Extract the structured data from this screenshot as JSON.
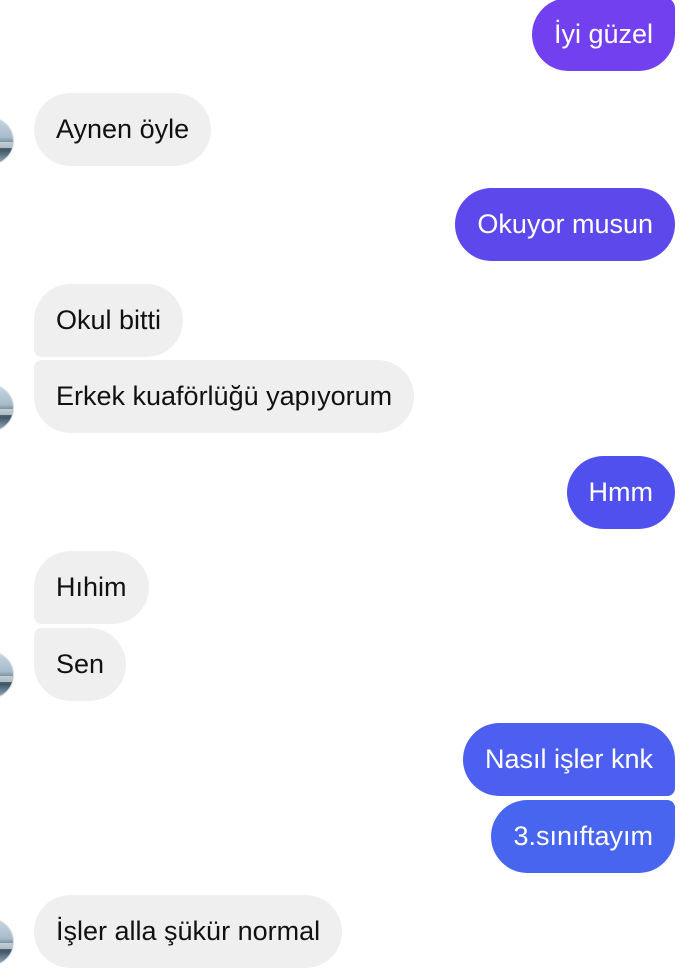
{
  "messages": [
    {
      "side": "out",
      "text": "İyi güzel",
      "color": "#7340ef"
    },
    {
      "side": "in",
      "text": "Aynen öyle"
    },
    {
      "side": "out",
      "text": "Okuyor musun",
      "color": "#5d48ec"
    },
    {
      "side": "in",
      "text": "Okul bitti"
    },
    {
      "side": "in",
      "text": "Erkek kuaförlüğü yapıyorum"
    },
    {
      "side": "out",
      "text": "Hmm",
      "color": "#5050ee"
    },
    {
      "side": "in",
      "text": "Hıhim"
    },
    {
      "side": "in",
      "text": "Sen"
    },
    {
      "side": "out",
      "text": "Nasıl işler knk",
      "color": "#4d5ff0"
    },
    {
      "side": "out",
      "text": "3.sınıftayım",
      "color": "#4865ef"
    },
    {
      "side": "in",
      "text": "İşler alla şükür normal"
    }
  ],
  "avatars": [
    {
      "name": "contact-avatar",
      "icon": "photo-avatar"
    },
    {
      "name": "contact-avatar",
      "icon": "photo-avatar"
    },
    {
      "name": "contact-avatar",
      "icon": "photo-avatar"
    },
    {
      "name": "contact-avatar",
      "icon": "photo-avatar"
    }
  ]
}
